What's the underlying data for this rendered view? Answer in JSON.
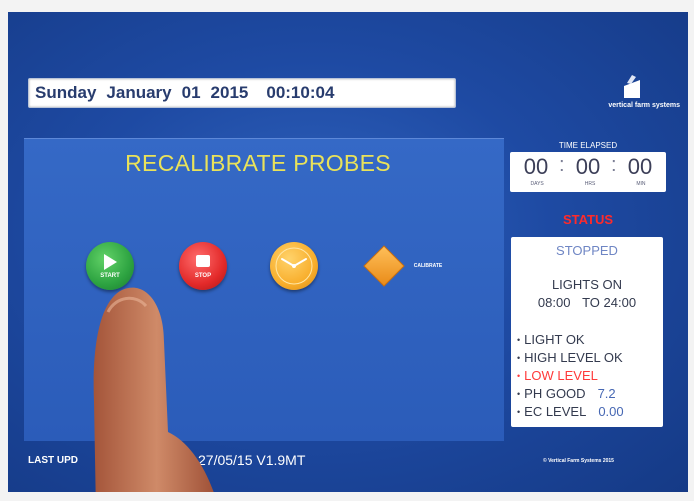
{
  "datetime": {
    "weekday": "Sunday",
    "month": "January",
    "day": "01",
    "year": "2015",
    "time": "00:10:04"
  },
  "logo": {
    "brand": "vertical farm systems"
  },
  "main": {
    "title": "RECALIBRATE PROBES",
    "buttons": {
      "start": "START",
      "stop": "STOP",
      "calibrate": "CALIBRATE"
    }
  },
  "elapsed": {
    "label": "TIME ELAPSED",
    "days": "00",
    "hrs": "00",
    "min": "00",
    "unit_days": "DAYS",
    "unit_hrs": "HRS",
    "unit_min": "MIN"
  },
  "status": {
    "title": "STATUS",
    "state": "STOPPED",
    "lights_title": "LIGHTS ON",
    "lights_from": "08:00",
    "lights_to_label": "TO",
    "lights_to": "24:00",
    "checks": [
      {
        "text": "LIGHT OK",
        "value": "",
        "alert": false
      },
      {
        "text": "HIGH LEVEL OK",
        "value": "",
        "alert": false
      },
      {
        "text": "LOW LEVEL",
        "value": "",
        "alert": true
      },
      {
        "text": "PH GOOD",
        "value": "7.2",
        "alert": false
      },
      {
        "text": "EC LEVEL",
        "value": "0.00",
        "alert": false
      }
    ]
  },
  "footer": {
    "last_updated_label": "LAST UPD",
    "version": "27/05/15 V1.9MT",
    "copyright": "© Vertical Farm Systems 2015"
  },
  "colors": {
    "screen_bg": "#2658b0",
    "title": "#e9e25a",
    "status_red": "#ff2a2a",
    "start_green": "#2da341",
    "stop_red": "#e32a2a",
    "clock_orange": "#f8ae2c"
  }
}
